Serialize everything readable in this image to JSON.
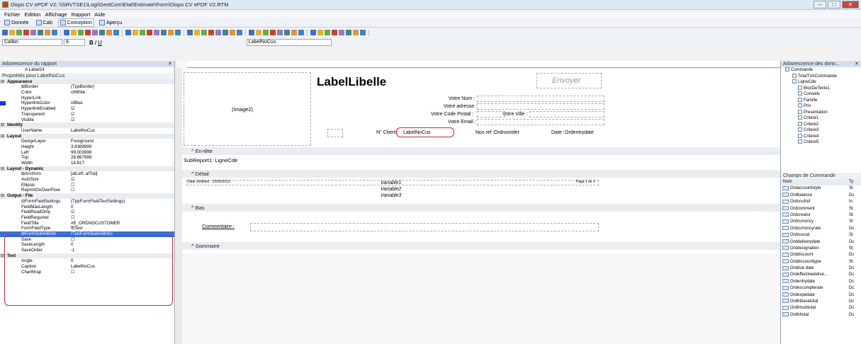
{
  "window": {
    "title": "Dispo CV ePDF V2: \\\\SRVTSE1\\Logi\\GestCom\\Etat\\Estimate\\Form\\Dispo CV ePDF V2.RTM"
  },
  "menu": [
    "Fichier",
    "Edition",
    "Affichage",
    "Rapport",
    "Aide"
  ],
  "tabs": [
    "Donnée",
    "Calc",
    "Conception",
    "Aperçu"
  ],
  "font": {
    "name": "Calibri",
    "size": "8",
    "component": "LabelNoCus"
  },
  "tree_header": "Arborescence du rapport",
  "tree_item": "A Label24",
  "props_header": "Propriétés pour LabelNoCus",
  "props": [
    {
      "cat": "Appearance"
    },
    {
      "k": "⊞Border",
      "v": "(TppBorder)"
    },
    {
      "k": "Color",
      "v": "clWhite"
    },
    {
      "k": "HyperLink",
      "v": ""
    },
    {
      "k": "HyperlinkColor",
      "v": "clBlue"
    },
    {
      "k": "HyperlinkEnabled",
      "v": "☑"
    },
    {
      "k": "Transparent",
      "v": "☑"
    },
    {
      "k": "Visible",
      "v": "☑"
    },
    {
      "cat": "Identity"
    },
    {
      "k": "UserName",
      "v": "LabelNoCus"
    },
    {
      "cat": "Layout"
    },
    {
      "k": "DesignLayer",
      "v": "Foreground"
    },
    {
      "k": "Height",
      "v": "3.4389999"
    },
    {
      "k": "Left",
      "v": "99.003998"
    },
    {
      "k": "Top",
      "v": "28.667999"
    },
    {
      "k": "Width",
      "v": "14.817"
    },
    {
      "cat": "Layout - Dynamic"
    },
    {
      "k": "⊞Anchors",
      "v": "[atLeft, atTop]"
    },
    {
      "k": "AutoSize",
      "v": "☑"
    },
    {
      "k": "Ellipsis",
      "v": "☐"
    },
    {
      "k": "ReprintOnOverFlow",
      "v": "☐"
    },
    {
      "cat": "Output - File"
    },
    {
      "k": "⊟FormFieldSettings",
      "v": "(TppFormFieldTextSettings)"
    },
    {
      "k": "FieldMaxLength",
      "v": "0"
    },
    {
      "k": "FieldReadOnly",
      "v": "☑"
    },
    {
      "k": "FieldRequired",
      "v": "☐"
    },
    {
      "k": "FieldTitle",
      "v": "#E_ORDNOCUSTOMER"
    },
    {
      "k": "FormFieldType",
      "v": "fftText"
    },
    {
      "k": "⊞FormSubmitInfo",
      "v": "(TppFormSubmitInfo)",
      "sel": true
    },
    {
      "k": "Save",
      "v": "☐"
    },
    {
      "k": "SaveLength",
      "v": "0"
    },
    {
      "k": "SaveOrder",
      "v": "-1"
    },
    {
      "cat": "Text"
    },
    {
      "k": "Angle",
      "v": "0"
    },
    {
      "k": "Caption",
      "v": "LabelNoCus"
    },
    {
      "k": "CharWrap",
      "v": "☐"
    }
  ],
  "report": {
    "title": "LabelLibelle",
    "envoyer": "Envoyer",
    "image": "(Image2)",
    "nom": "Votre Nom :",
    "adresse": "Votre adresse :",
    "cp": "Votre Code Postal :",
    "ville": "Votre Ville :",
    "email": "Votre Email :",
    "client": "N° Client :",
    "labelno": "LabelNoCus",
    "nosref": "Nos ref :",
    "ordnoorder": "Ordnoorder",
    "date": "Date :",
    "ordentrydate": "Ordentrydate",
    "band_entete": "^ En-tête",
    "subreport": "SubReport1: LigneCde",
    "band_detail": "^ Détail",
    "edition": "Date d'édition : 23/09/2019",
    "var1": "Variable1",
    "var2": "Variable2",
    "var3": "Variable3",
    "page": "Page 1 de 3",
    "band_bas": "^ Bas",
    "commentaire": "Commentaire :",
    "band_sommaire": "^ Sommaire"
  },
  "right_tree_header": "Arborescence des donn...",
  "right_tree": [
    "Commande",
    "TotalTVACommande",
    "LigneCde",
    "BlocDeTexte1",
    "Conseils",
    "Famille",
    "Prix",
    "Presentation",
    "Critere1",
    "Critere2",
    "Critere3",
    "Critere4",
    "Critere5"
  ],
  "fields_header": "Champs de Commande",
  "fields_col": [
    "Nom",
    "Ty"
  ],
  "fields": [
    [
      "Ordaccountstyle",
      "St"
    ],
    [
      "Ordbalance",
      "Dc"
    ],
    [
      "Ordcnufref",
      "In"
    ],
    [
      "Ordcomment",
      "St"
    ],
    [
      "Ordcreator",
      "St"
    ],
    [
      "Ordcurrency",
      "St"
    ],
    [
      "Ordcurrencyrate",
      "Dc"
    ],
    [
      "Ordcuscat",
      "St"
    ],
    [
      "Orddeliverydate",
      "Dc"
    ],
    [
      "Orddesignation",
      "St"
    ],
    [
      "Orddiscount",
      "Dc"
    ],
    [
      "Orddiscounttype",
      "St"
    ],
    [
      "Orddue date",
      "Dc"
    ],
    [
      "Ordeffectivedelive...",
      "Dc"
    ],
    [
      "Ordentrydate",
      "Dc"
    ],
    [
      "Ordescompterate",
      "Dc"
    ],
    [
      "Ordexpedate",
      "Dc"
    ],
    [
      "Ordhtbasetotal",
      "Dc"
    ],
    [
      "Ordhtsubtotal",
      "Dc"
    ],
    [
      "Ordhttotal",
      "Dc"
    ]
  ]
}
